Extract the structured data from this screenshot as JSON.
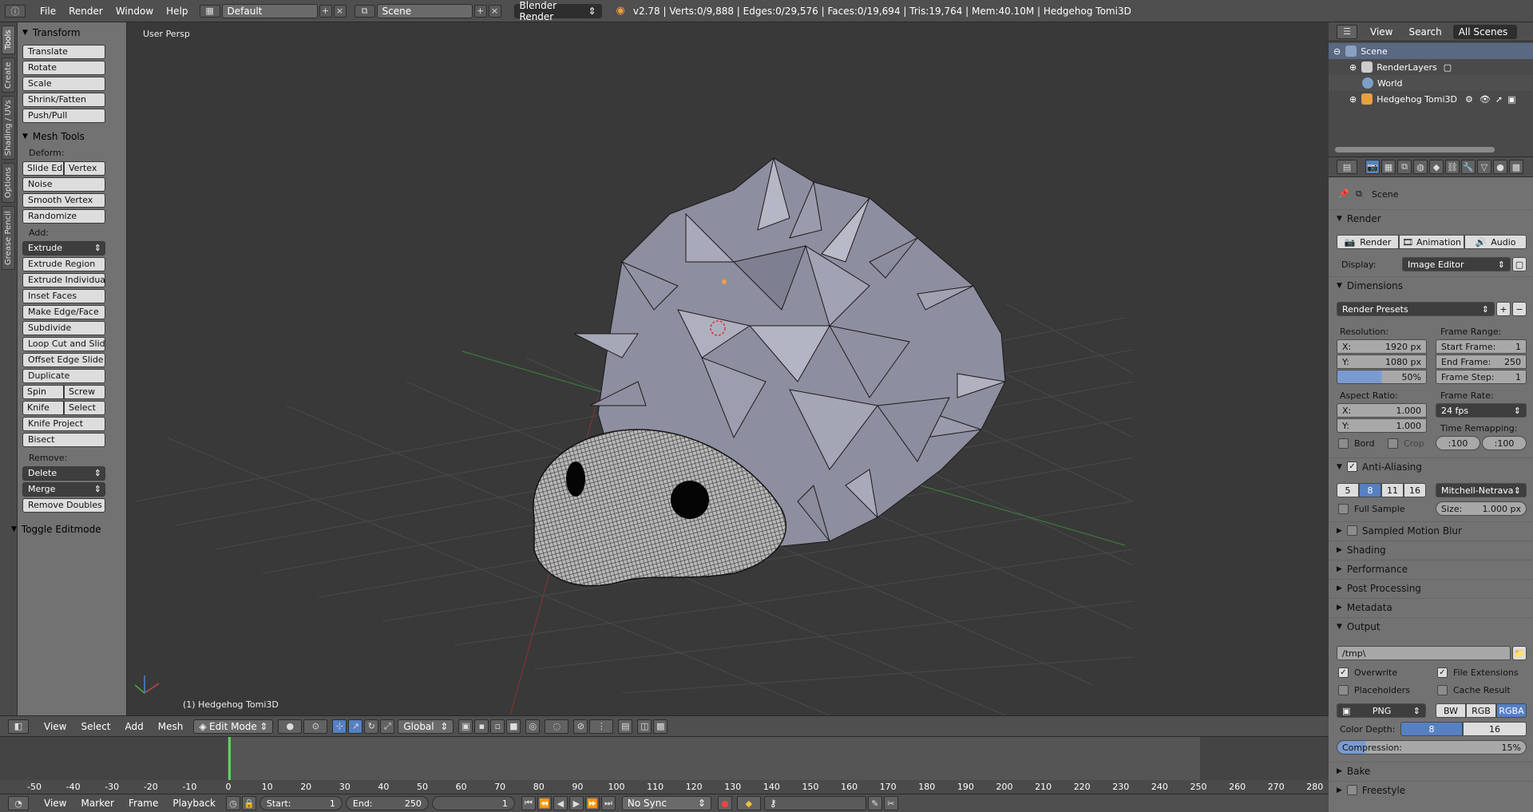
{
  "topbar": {
    "menus": [
      "File",
      "Render",
      "Window",
      "Help"
    ],
    "layout": "Default",
    "scene": "Scene",
    "engine": "Blender Render",
    "stats": "v2.78 | Verts:0/9,888 | Edges:0/29,576 | Faces:0/19,694 | Tris:19,764 | Mem:40.10M | Hedgehog Tomi3D"
  },
  "left_tabs": [
    "Tools",
    "Create",
    "Shading / UVs",
    "Options",
    "Grease Pencil"
  ],
  "toolshelf": {
    "transform_title": "Transform",
    "transform_buttons": [
      "Translate",
      "Rotate",
      "Scale",
      "Shrink/Fatten",
      "Push/Pull"
    ],
    "mesh_tools_title": "Mesh Tools",
    "deform_label": "Deform:",
    "slide_edge": "Slide Ed",
    "vertex": "Vertex",
    "noise": "Noise",
    "smooth_vertex": "Smooth Vertex",
    "randomize": "Randomize",
    "add_label": "Add:",
    "extrude": "Extrude",
    "add_buttons": [
      "Extrude Region",
      "Extrude Individual",
      "Inset Faces",
      "Make Edge/Face",
      "Subdivide",
      "Loop Cut and Slide",
      "Offset Edge Slide",
      "Duplicate"
    ],
    "spin": "Spin",
    "screw": "Screw",
    "knife": "Knife",
    "select": "Select",
    "knife_project": "Knife Project",
    "bisect": "Bisect",
    "remove_label": "Remove:",
    "delete": "Delete",
    "merge": "Merge",
    "remove_doubles": "Remove Doubles",
    "toggle_editmode": "Toggle Editmode"
  },
  "viewport": {
    "view_name": "User Persp",
    "object_label": "(1) Hedgehog Tomi3D"
  },
  "vp_header": {
    "menus": [
      "View",
      "Select",
      "Add",
      "Mesh"
    ],
    "mode": "Edit Mode",
    "orientation": "Global"
  },
  "timeline": {
    "ticks": [
      -50,
      -40,
      -30,
      -20,
      -10,
      0,
      10,
      20,
      30,
      40,
      50,
      60,
      70,
      80,
      90,
      100,
      110,
      120,
      130,
      140,
      150,
      160,
      170,
      180,
      190,
      200,
      210,
      220,
      230,
      240,
      250,
      260,
      270,
      280
    ],
    "current_frame_marker": 0
  },
  "bottombar": {
    "menus": [
      "View",
      "Marker",
      "Frame",
      "Playback"
    ],
    "start_label": "Start:",
    "start_value": "1",
    "end_label": "End:",
    "end_value": "250",
    "current_value": "1",
    "sync": "No Sync"
  },
  "outliner": {
    "menus": [
      "View",
      "Search"
    ],
    "filter": "All Scenes",
    "rows": [
      "Scene",
      "RenderLayers",
      "World",
      "Hedgehog Tomi3D"
    ]
  },
  "properties": {
    "context": "Scene",
    "render_section": "Render",
    "render_btn": "Render",
    "animation_btn": "Animation",
    "audio_btn": "Audio",
    "display_label": "Display:",
    "display_value": "Image Editor",
    "dimensions_section": "Dimensions",
    "render_presets": "Render Presets",
    "resolution_label": "Resolution:",
    "res_x_label": "X:",
    "res_x": "1920 px",
    "res_y_label": "Y:",
    "res_y": "1080 px",
    "res_pct": "50%",
    "frame_range_label": "Frame Range:",
    "start_frame_label": "Start Frame:",
    "start_frame": "1",
    "end_frame_label": "End Frame:",
    "end_frame": "250",
    "frame_step_label": "Frame Step:",
    "frame_step": "1",
    "aspect_label": "Aspect Ratio:",
    "aspect_x_label": "X:",
    "aspect_x": "1.000",
    "aspect_y_label": "Y:",
    "aspect_y": "1.000",
    "frame_rate_label": "Frame Rate:",
    "frame_rate": "24 fps",
    "time_remap_label": "Time Remapping:",
    "remap_old": ":100",
    "remap_new": ":100",
    "bord": "Bord",
    "crop": "Crop",
    "aa_section": "Anti-Aliasing",
    "aa_samples": [
      "5",
      "8",
      "11",
      "16"
    ],
    "aa_filter": "Mitchell-Netravali",
    "full_sample": "Full Sample",
    "size_label": "Size:",
    "size_value": "1.000 px",
    "collapsed_sections": [
      "Sampled Motion Blur",
      "Shading",
      "Performance",
      "Post Processing",
      "Metadata"
    ],
    "output_section": "Output",
    "output_path": "/tmp\\",
    "overwrite": "Overwrite",
    "file_extensions": "File Extensions",
    "placeholders": "Placeholders",
    "cache_result": "Cache Result",
    "format": "PNG",
    "bw": "BW",
    "rgb": "RGB",
    "rgba": "RGBA",
    "color_depth_label": "Color Depth:",
    "depth_8": "8",
    "depth_16": "16",
    "compression_label": "Compression:",
    "compression_value": "15%",
    "bake_section": "Bake",
    "freestyle_section": "Freestyle"
  },
  "colors": {
    "accent_blue": "#5680c2",
    "mesh": "#8a8c9c",
    "viewport_bg": "#393939"
  }
}
